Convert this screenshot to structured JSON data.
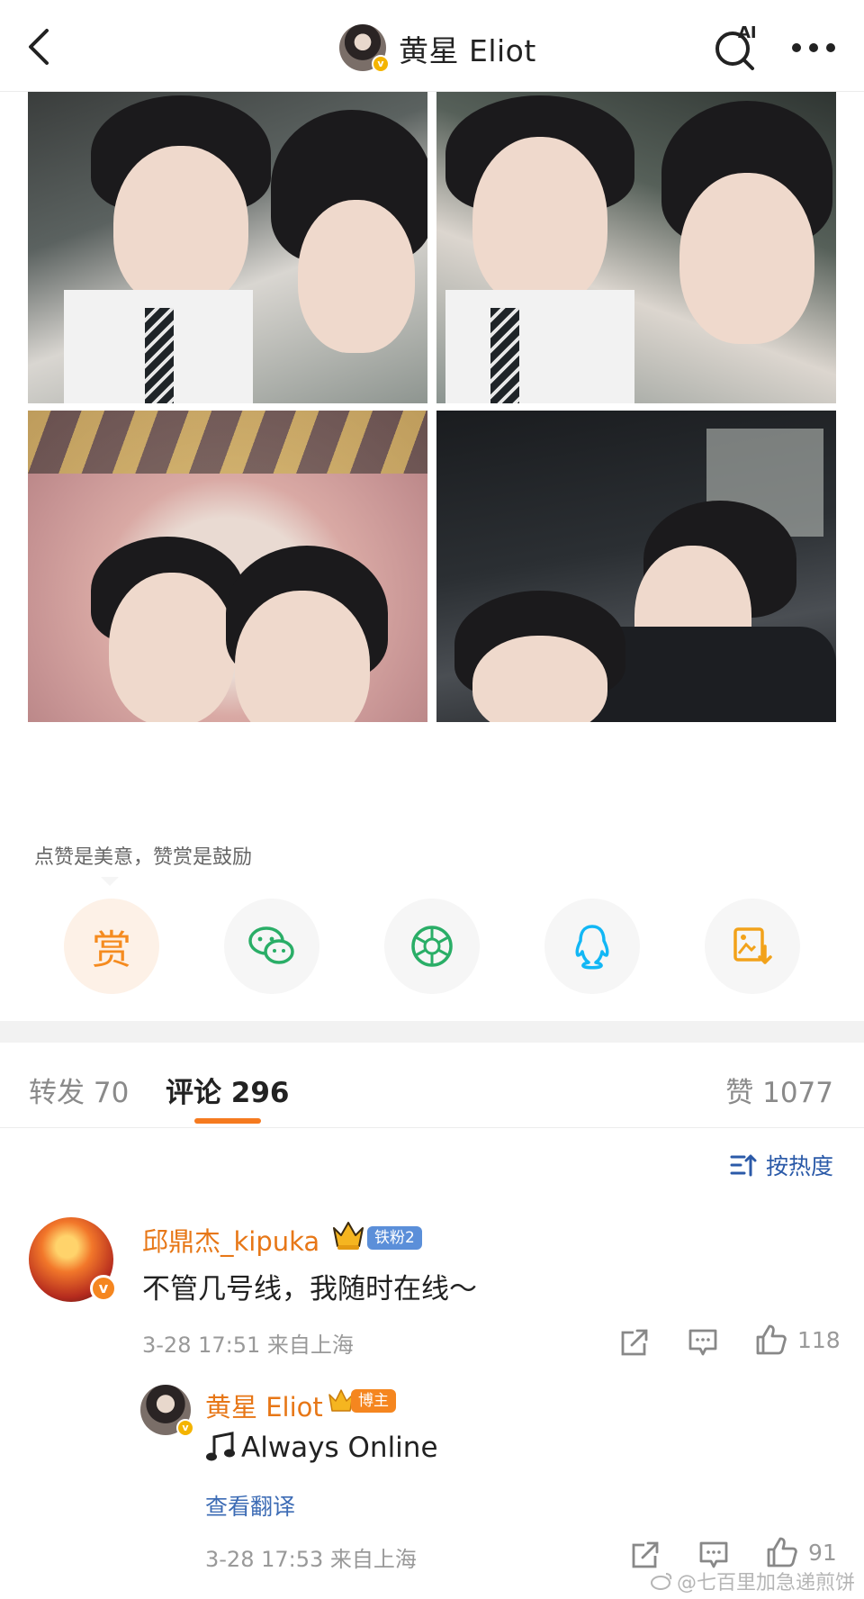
{
  "header": {
    "title": "黄星 Eliot",
    "ai_label": "AI"
  },
  "post": {
    "photos": [
      "photo-1",
      "photo-2",
      "photo-3",
      "photo-4"
    ],
    "reward_tip": "点赞是美意，赞赏是鼓励",
    "reward_label": "赏"
  },
  "share": {
    "items": [
      "reward",
      "wechat",
      "wechat-moments",
      "qq",
      "save-image"
    ]
  },
  "tabs": {
    "repost": "转发 70",
    "comment": "评论 296",
    "like": "赞 1077"
  },
  "sort": {
    "label": "按热度"
  },
  "comment": {
    "user": "邱鼎杰_kipuka",
    "fan_badge": "铁粉2",
    "text": "不管几号线，我随时在线～",
    "meta": "3-28 17:51 来自上海",
    "likes": "118"
  },
  "reply": {
    "user": "黄星 Eliot",
    "badge": "博主",
    "text": "Always Online",
    "translate": "查看翻译",
    "meta": "3-28 17:53 来自上海",
    "likes": "91"
  },
  "watermark": "@七百里加急递煎饼",
  "colors": {
    "accent": "#f57a1f",
    "username": "#e77717",
    "link": "#2b5aa8",
    "wechat": "#2aae67",
    "qq": "#12b7f5"
  }
}
